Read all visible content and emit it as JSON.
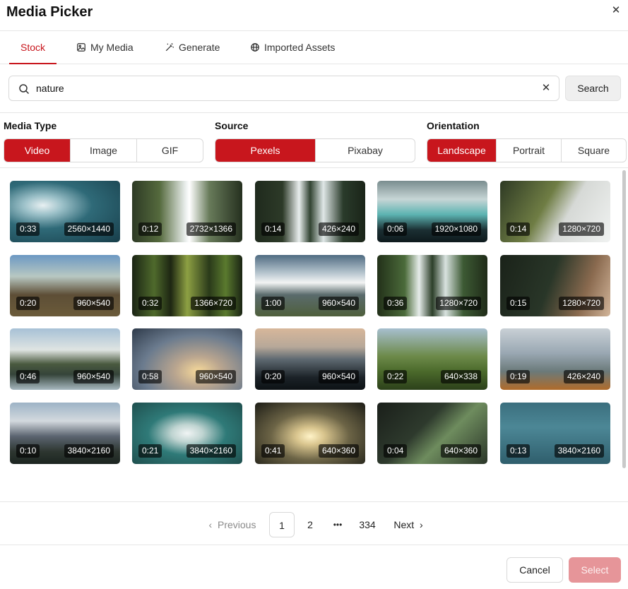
{
  "dialog": {
    "title": "Media Picker"
  },
  "tabs": [
    {
      "label": "Stock",
      "icon": "none",
      "active": true
    },
    {
      "label": "My Media",
      "icon": "image-icon",
      "active": false
    },
    {
      "label": "Generate",
      "icon": "magic-wand-icon",
      "active": false
    },
    {
      "label": "Imported Assets",
      "icon": "globe-icon",
      "active": false
    }
  ],
  "search": {
    "value": "nature",
    "placeholder": "",
    "button_label": "Search"
  },
  "filters": {
    "media_type": {
      "label": "Media Type",
      "options": [
        "Video",
        "Image",
        "GIF"
      ],
      "selected": "Video"
    },
    "source": {
      "label": "Source",
      "options": [
        "Pexels",
        "Pixabay"
      ],
      "selected": "Pexels"
    },
    "orientation": {
      "label": "Orientation",
      "options": [
        "Landscape",
        "Portrait",
        "Square"
      ],
      "selected": "Landscape"
    }
  },
  "results": [
    {
      "duration": "0:33",
      "resolution": "2560×1440"
    },
    {
      "duration": "0:12",
      "resolution": "2732×1366"
    },
    {
      "duration": "0:14",
      "resolution": "426×240"
    },
    {
      "duration": "0:06",
      "resolution": "1920×1080"
    },
    {
      "duration": "0:14",
      "resolution": "1280×720"
    },
    {
      "duration": "0:20",
      "resolution": "960×540"
    },
    {
      "duration": "0:32",
      "resolution": "1366×720"
    },
    {
      "duration": "1:00",
      "resolution": "960×540"
    },
    {
      "duration": "0:36",
      "resolution": "1280×720"
    },
    {
      "duration": "0:15",
      "resolution": "1280×720"
    },
    {
      "duration": "0:46",
      "resolution": "960×540"
    },
    {
      "duration": "0:58",
      "resolution": "960×540"
    },
    {
      "duration": "0:20",
      "resolution": "960×540"
    },
    {
      "duration": "0:22",
      "resolution": "640×338"
    },
    {
      "duration": "0:19",
      "resolution": "426×240"
    },
    {
      "duration": "0:10",
      "resolution": "3840×2160"
    },
    {
      "duration": "0:21",
      "resolution": "3840×2160"
    },
    {
      "duration": "0:41",
      "resolution": "640×360"
    },
    {
      "duration": "0:04",
      "resolution": "640×360"
    },
    {
      "duration": "0:13",
      "resolution": "3840×2160"
    }
  ],
  "pagination": {
    "previous_label": "Previous",
    "next_label": "Next",
    "pages": [
      "1",
      "2",
      "•••",
      "334"
    ],
    "current": "1"
  },
  "footer": {
    "cancel_label": "Cancel",
    "select_label": "Select"
  },
  "colors": {
    "accent": "#c8161d",
    "select_disabled": "#e69599"
  }
}
